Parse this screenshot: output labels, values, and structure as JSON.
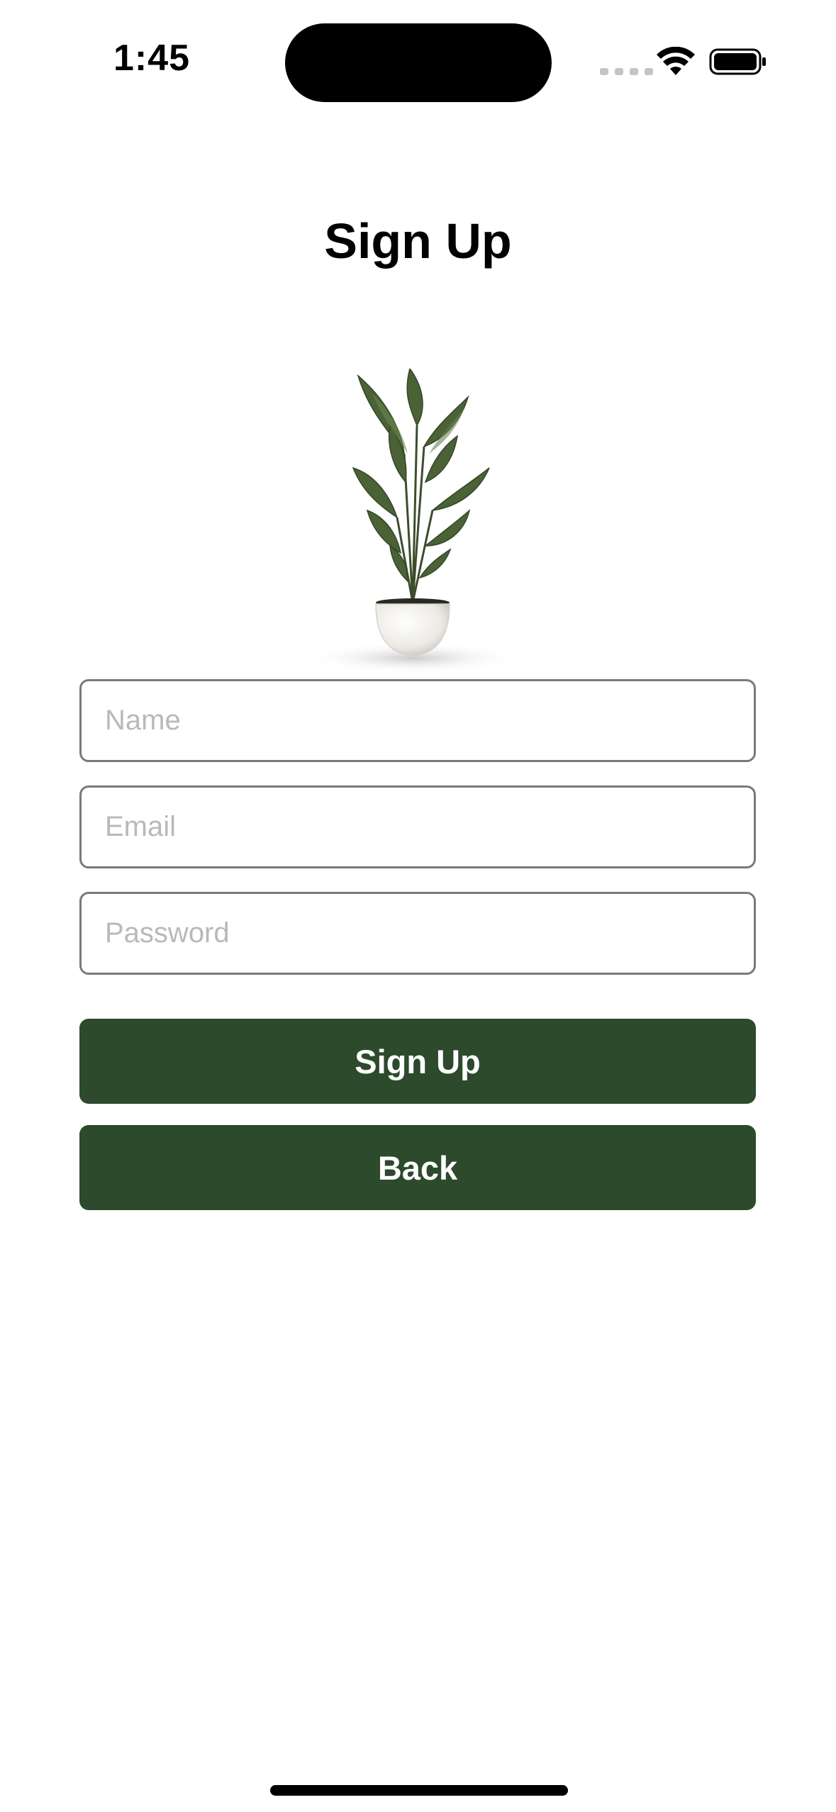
{
  "status_bar": {
    "time": "1:45"
  },
  "page": {
    "title": "Sign Up"
  },
  "form": {
    "name_placeholder": "Name",
    "email_placeholder": "Email",
    "password_placeholder": "Password",
    "name_value": "",
    "email_value": "",
    "password_value": ""
  },
  "buttons": {
    "sign_up_label": "Sign Up",
    "back_label": "Back"
  },
  "colors": {
    "primary_button": "#2d4a2c",
    "field_border": "#7a7a7a",
    "placeholder": "#b9b9b9"
  },
  "icons": {
    "wifi": "wifi-icon",
    "battery": "battery-icon",
    "plant": "potted-plant-image"
  }
}
